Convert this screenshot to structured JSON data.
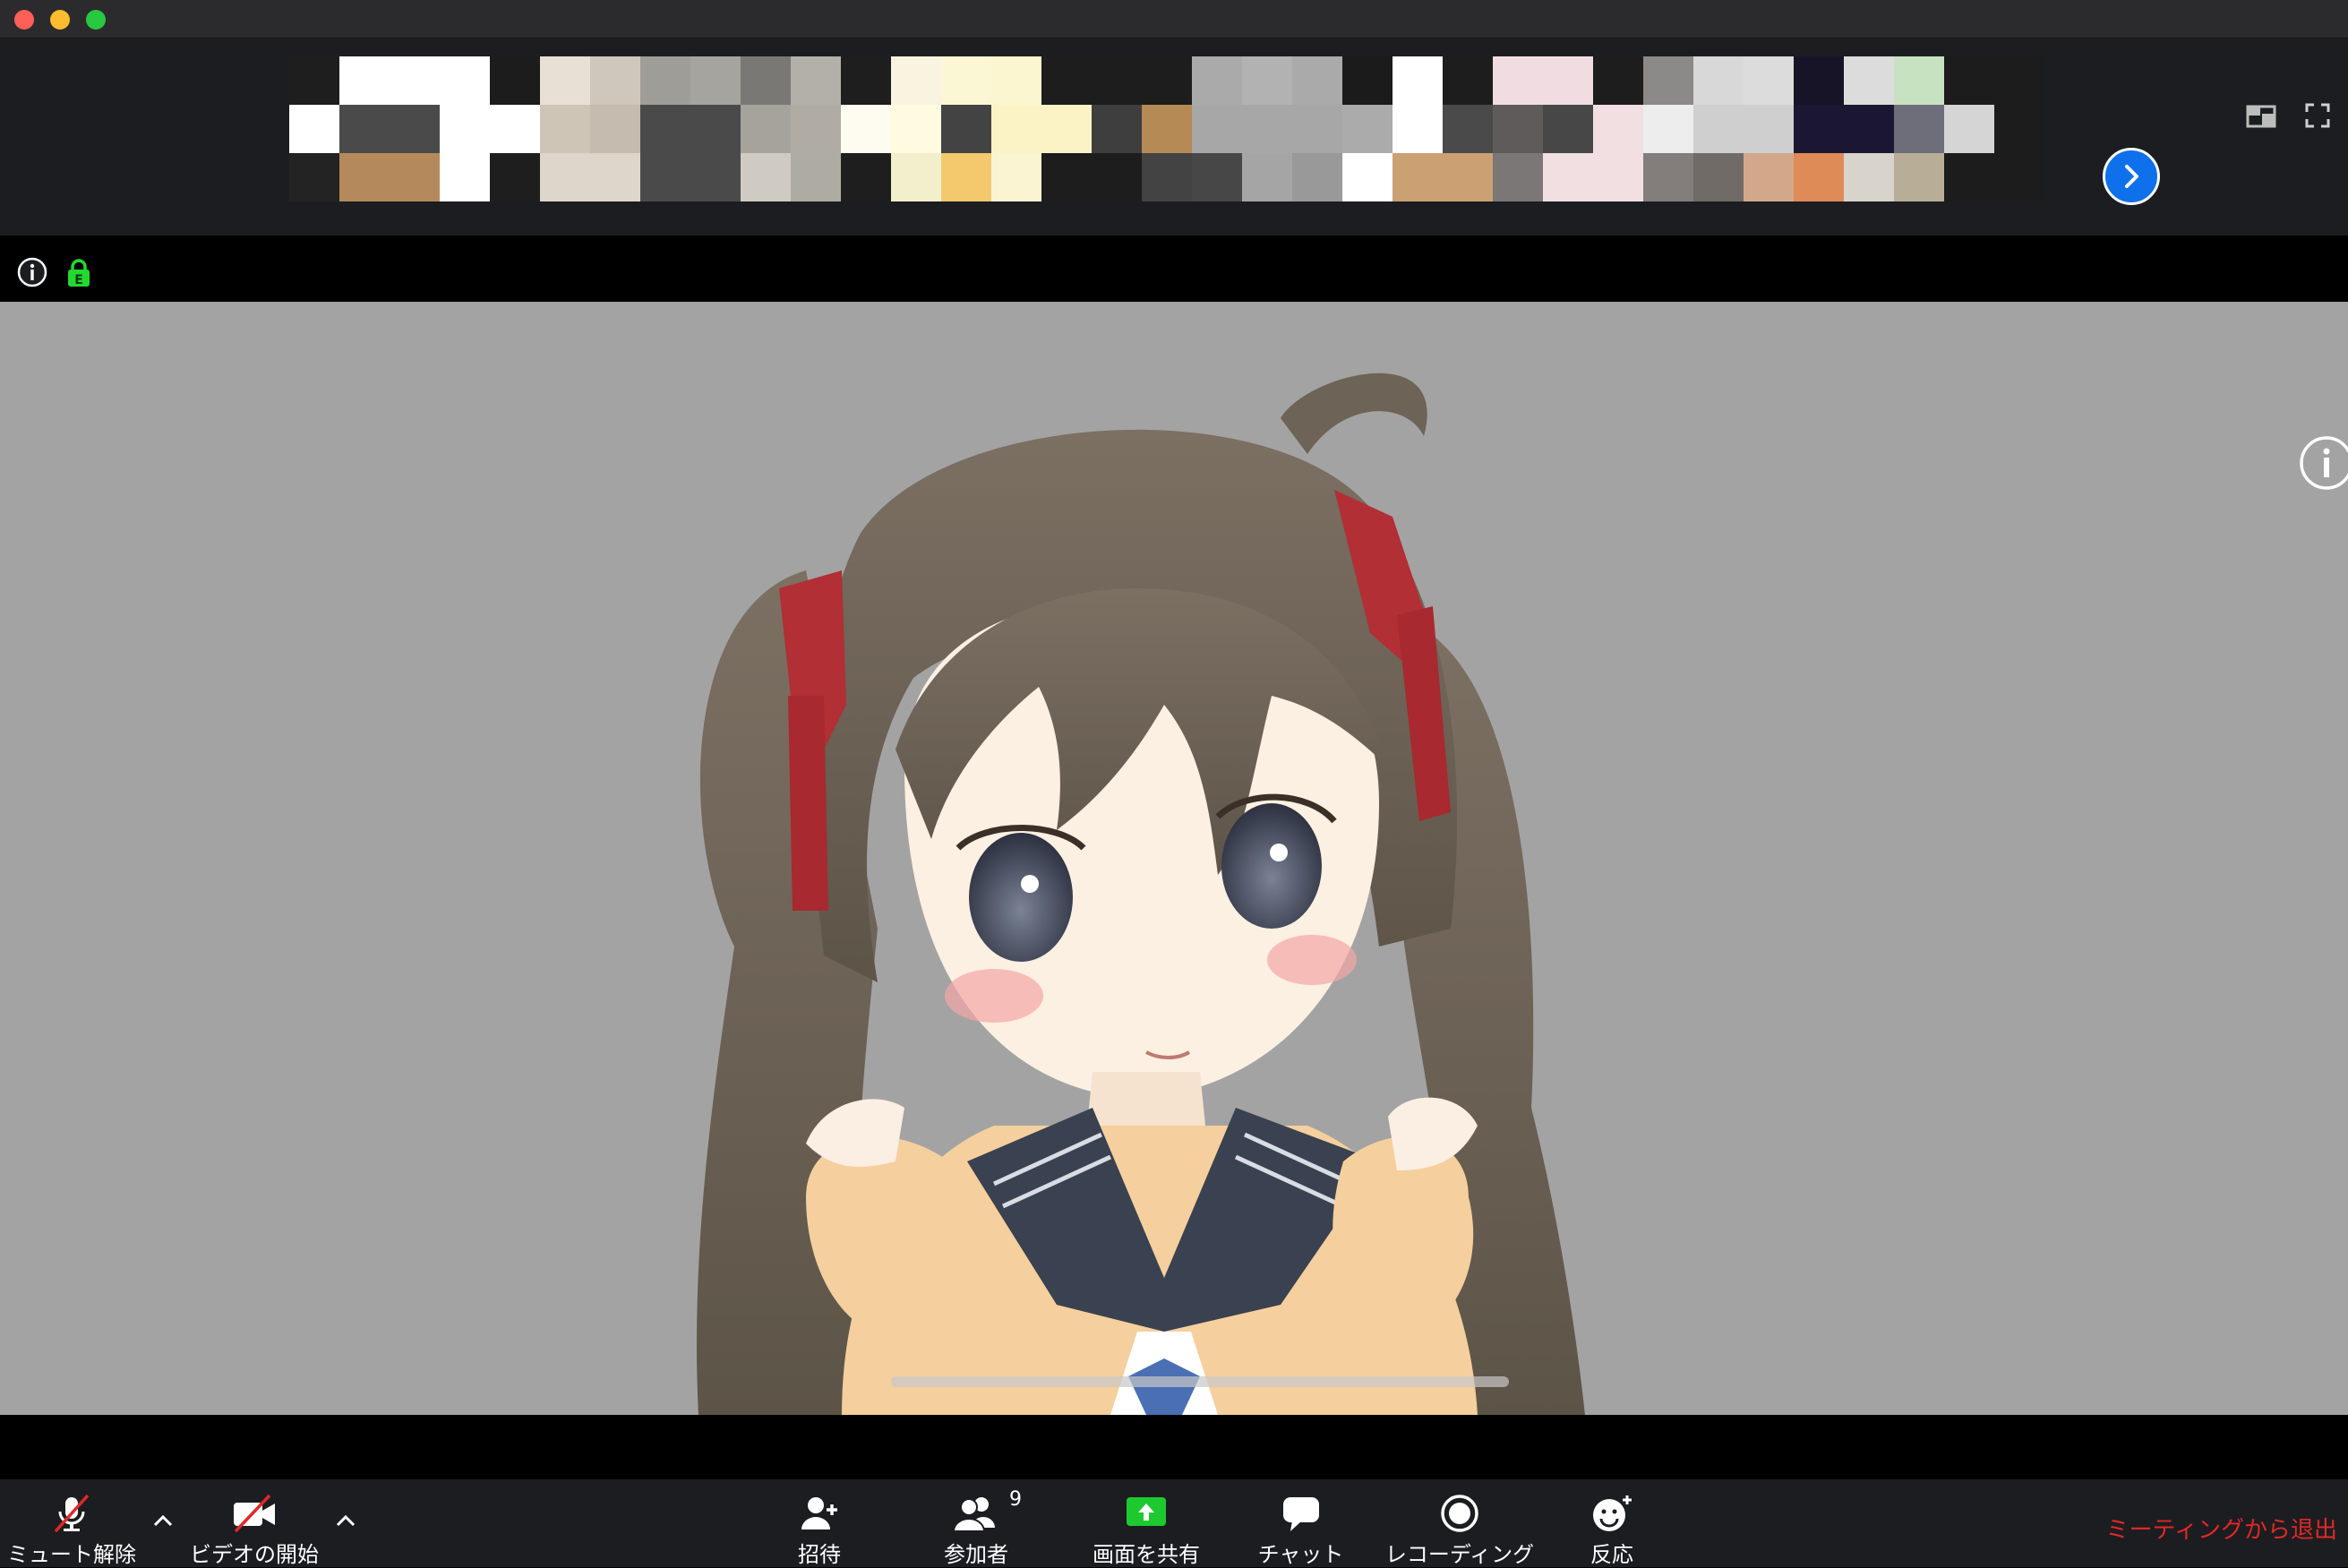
{
  "window": {
    "controls": [
      "close",
      "minimize",
      "zoom"
    ]
  },
  "gallery": {
    "next_icon": "chevron-right-icon",
    "view_icons": [
      "speaker-view-icon",
      "fullscreen-icon"
    ]
  },
  "meeting_info": {
    "info_icon": "info-icon",
    "encryption_icon": "lock-icon",
    "encryption_badge": "E"
  },
  "video": {
    "side_info_icon": "info-icon"
  },
  "toolbar": {
    "unmute_label": "ミュート解除",
    "start_video_label": "ビデオの開始",
    "invite_label": "招待",
    "participants_label": "参加者",
    "participants_count": "9",
    "share_screen_label": "画面を共有",
    "chat_label": "チャット",
    "recording_label": "レコーディング",
    "reactions_label": "反応",
    "leave_label": "ミーティングから退出"
  },
  "colors": {
    "accent_blue": "#0e71eb",
    "share_green": "#1ec92f",
    "leave_red": "#e02828",
    "mute_slash": "#e02828"
  }
}
